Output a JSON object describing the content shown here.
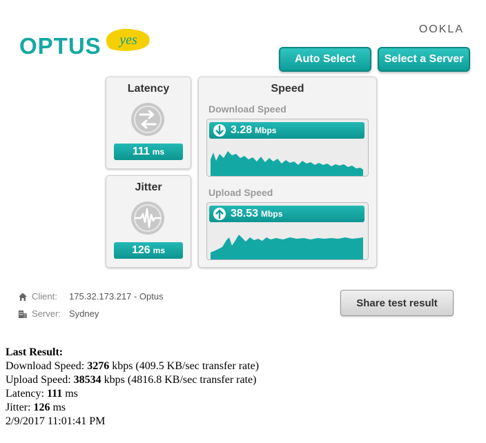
{
  "brand": {
    "logo_text": "OPTUS",
    "logo_yes": "yes",
    "ookla": "OOKLA"
  },
  "buttons": {
    "auto_select": "Auto Select",
    "select_server": "Select a Server",
    "share": "Share test result"
  },
  "latency": {
    "title": "Latency",
    "value": "111",
    "unit": "ms",
    "icon": "arrows-exchange-icon"
  },
  "jitter": {
    "title": "Jitter",
    "value": "126",
    "unit": "ms",
    "icon": "pulse-wave-icon"
  },
  "speed": {
    "title": "Speed",
    "download": {
      "label": "Download Speed",
      "value": "3.28",
      "unit": "Mbps"
    },
    "upload": {
      "label": "Upload Speed",
      "value": "38.53",
      "unit": "Mbps"
    }
  },
  "info": {
    "client_label": "Client:",
    "client_value": "175.32.173.217 - Optus",
    "server_label": "Server:",
    "server_value": "Sydney"
  },
  "last_result": {
    "heading": "Last Result:",
    "download_prefix": "Download Speed: ",
    "download_value": "3276",
    "download_suffix": " kbps (409.5 KB/sec transfer rate)",
    "upload_prefix": "Upload Speed: ",
    "upload_value": "38534",
    "upload_suffix": " kbps (4816.8 KB/sec transfer rate)",
    "latency_prefix": "Latency: ",
    "latency_value": "111",
    "latency_suffix": " ms",
    "jitter_prefix": "Jitter: ",
    "jitter_value": "126",
    "jitter_suffix": " ms",
    "timestamp": "2/9/2017 11:01:41 PM"
  },
  "colors": {
    "accent": "#14a8a4",
    "accent_dark": "#0d9591",
    "yes_yellow": "#f5d000"
  }
}
